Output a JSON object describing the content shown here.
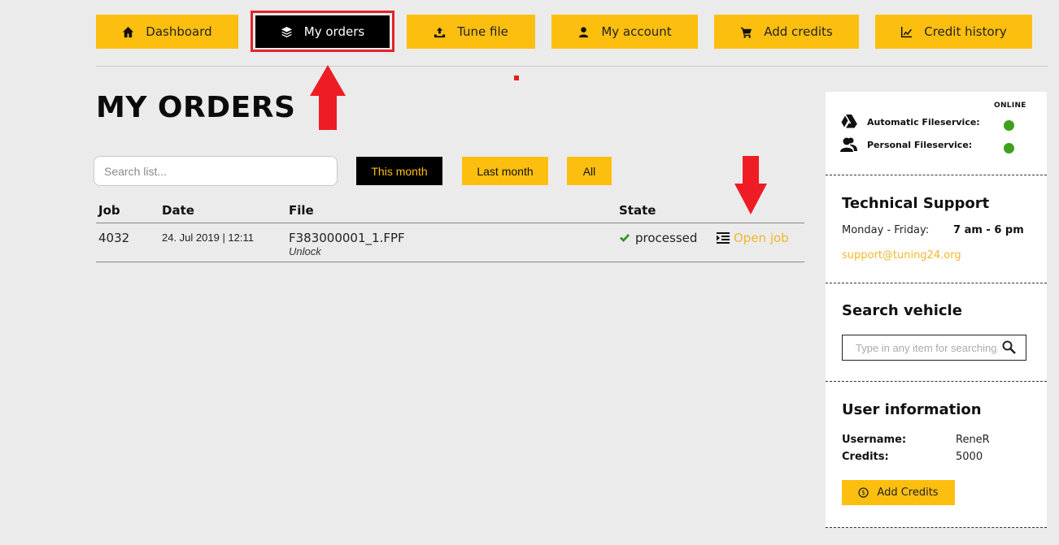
{
  "nav": {
    "dashboard": "Dashboard",
    "my_orders": "My orders",
    "tune_file": "Tune file",
    "my_account": "My account",
    "add_credits": "Add credits",
    "credit_history": "Credit history",
    "active": "My orders"
  },
  "page": {
    "title": "MY ORDERS"
  },
  "search": {
    "placeholder": "Search list..."
  },
  "filters": {
    "this_month": "This month",
    "last_month": "Last month",
    "all": "All",
    "selected": "This month"
  },
  "table": {
    "headers": {
      "job": "Job",
      "date": "Date",
      "file": "File",
      "state": "State"
    },
    "rows": [
      {
        "job": "4032",
        "date": "24. Jul 2019 | 12:11",
        "file": "F383000001_1.FPF",
        "sub": "Unlock",
        "state": "processed",
        "action": "Open job"
      }
    ]
  },
  "sidebar": {
    "status": {
      "online_label": "ONLINE",
      "automatic": "Automatic Fileservice:",
      "personal": "Personal Fileservice:",
      "automatic_online": true,
      "personal_online": true
    },
    "support": {
      "title": "Technical Support",
      "days": "Monday - Friday:",
      "hours": "7 am - 6 pm",
      "email": "support@tuning24.org"
    },
    "vehicle": {
      "title": "Search vehicle",
      "placeholder": "Type in any item for searching..."
    },
    "user": {
      "title": "User information",
      "username_label": "Username:",
      "username": "ReneR",
      "credits_label": "Credits:",
      "credits": "5000",
      "add_credits_button": "Add Credits"
    }
  },
  "colors": {
    "accent": "#fdbf0f",
    "active_bg": "#000000",
    "highlight": "#e4232b",
    "online": "#3fa01e",
    "link": "#f2b72a"
  }
}
